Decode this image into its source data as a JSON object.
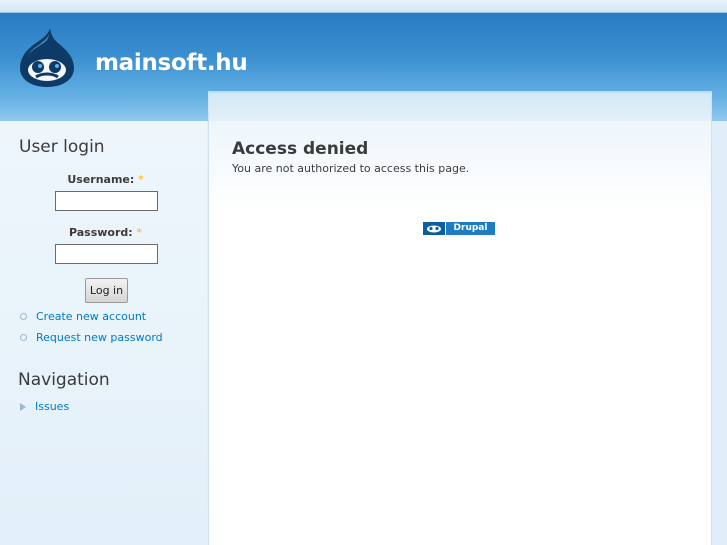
{
  "site": {
    "name": "mainsoft.hu",
    "logo_icon": "drupal-drop-icon"
  },
  "sidebar": {
    "user_login": {
      "title": "User login",
      "username_label": "Username:",
      "password_label": "Password:",
      "required_mark": "*",
      "username_value": "",
      "password_value": "",
      "login_button": "Log in",
      "links": [
        {
          "label": "Create new account"
        },
        {
          "label": "Request new password"
        }
      ]
    },
    "navigation": {
      "title": "Navigation",
      "items": [
        {
          "label": "Issues"
        }
      ]
    }
  },
  "main": {
    "title": "Access denied",
    "message": "You are not authorized to access this page."
  },
  "footer": {
    "badge_label": "Drupal",
    "badge_icon": "drupal-drop-icon"
  },
  "colors": {
    "header_blue": "#2a7cc2",
    "link": "#027ac6",
    "required": "#ffae00"
  }
}
